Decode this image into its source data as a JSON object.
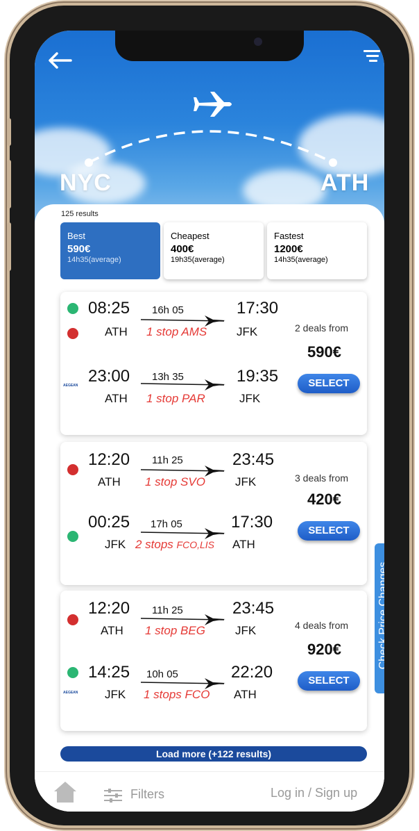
{
  "header": {
    "from": "NYC",
    "to": "ATH"
  },
  "results_count": "125 results",
  "tabs": [
    {
      "label": "Best",
      "price": "590€",
      "time": "14h35(average)"
    },
    {
      "label": "Cheapest",
      "price": "400€",
      "time": "19h35(average)"
    },
    {
      "label": "Fastest",
      "price": "1200€",
      "time": "14h35(average)"
    }
  ],
  "deals": [
    {
      "legs": [
        {
          "depart": "08:25",
          "from": "ATH",
          "duration": "16h 05",
          "stops": "1 stop AMS",
          "arrive": "17:30",
          "to": "JFK"
        },
        {
          "depart": "23:00",
          "from": "ATH",
          "duration": "13h 35",
          "stops": "1  stop PAR",
          "arrive": "19:35",
          "to": "JFK"
        }
      ],
      "deals_label": "2 deals from",
      "price": "590€",
      "select": "SELECT"
    },
    {
      "legs": [
        {
          "depart": "12:20",
          "from": "ATH",
          "duration": "11h 25",
          "stops": "1 stop SVO",
          "arrive": "23:45",
          "to": "JFK"
        },
        {
          "depart": "00:25",
          "from": "JFK",
          "duration": "17h 05",
          "stops": "2 stops",
          "stops_small": "FCO,LIS",
          "arrive": "17:30",
          "to": "ATH"
        }
      ],
      "deals_label": "3 deals from",
      "price": "420€",
      "select": "SELECT"
    },
    {
      "legs": [
        {
          "depart": "12:20",
          "from": "ATH",
          "duration": "11h 25",
          "stops": "1 stop BEG",
          "arrive": "23:45",
          "to": "JFK"
        },
        {
          "depart": "14:25",
          "from": "JFK",
          "duration": "10h 05",
          "stops": "1 stops FCO",
          "arrive": "22:20",
          "to": "ATH"
        }
      ],
      "deals_label": "4 deals from",
      "price": "920€",
      "select": "SELECT"
    }
  ],
  "airline_logo_text": "AEGEAN",
  "load_more": "Load more (+122 results)",
  "side_tab": "Check Price Changes",
  "bottom": {
    "filters": "Filters",
    "login": "Log in / Sign up"
  },
  "colors": {
    "accent": "#2e6fc1",
    "stop_red": "#e53935",
    "select_blue": "#1f5dc7",
    "load_more": "#1b4a9c",
    "side_tab": "#3d8fe0",
    "green_badge": "#2bb673",
    "red_badge": "#d32f2f"
  }
}
